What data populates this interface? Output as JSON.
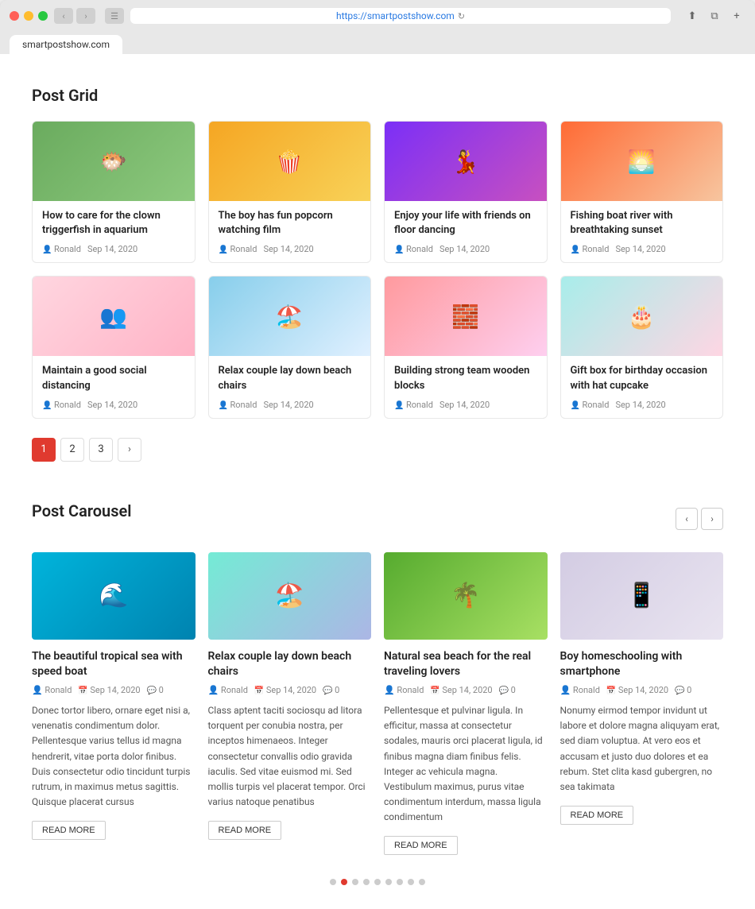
{
  "browser": {
    "url": "https://smartpostshow.com",
    "tab_label": "smartpostshow.com"
  },
  "page": {
    "post_grid": {
      "section_title": "Post Grid",
      "posts": [
        {
          "id": 1,
          "title": "How to care for the clown triggerfish in aquarium",
          "author": "Ronald",
          "date": "Sep 14, 2020",
          "img_class": "img-fish",
          "img_emoji": "🐡"
        },
        {
          "id": 2,
          "title": "The boy has fun popcorn watching film",
          "author": "Ronald",
          "date": "Sep 14, 2020",
          "img_class": "img-popcorn",
          "img_emoji": "🍿"
        },
        {
          "id": 3,
          "title": "Enjoy your life with friends on floor dancing",
          "author": "Ronald",
          "date": "Sep 14, 2020",
          "img_class": "img-dance",
          "img_emoji": "💃"
        },
        {
          "id": 4,
          "title": "Fishing boat river with breathtaking sunset",
          "author": "Ronald",
          "date": "Sep 14, 2020",
          "img_class": "img-sunset",
          "img_emoji": "🌅"
        },
        {
          "id": 5,
          "title": "Maintain a good social distancing",
          "author": "Ronald",
          "date": "Sep 14, 2020",
          "img_class": "img-social",
          "img_emoji": "👥"
        },
        {
          "id": 6,
          "title": "Relax couple lay down beach chairs",
          "author": "Ronald",
          "date": "Sep 14, 2020",
          "img_class": "img-beach-chairs",
          "img_emoji": "🏖️"
        },
        {
          "id": 7,
          "title": "Building strong team wooden blocks",
          "author": "Ronald",
          "date": "Sep 14, 2020",
          "img_class": "img-blocks",
          "img_emoji": "🧱"
        },
        {
          "id": 8,
          "title": "Gift box for birthday occasion with hat cupcake",
          "author": "Ronald",
          "date": "Sep 14, 2020",
          "img_class": "img-birthday",
          "img_emoji": "🎂"
        }
      ],
      "pagination": {
        "pages": [
          "1",
          "2",
          "3"
        ],
        "active": "1",
        "next_label": "›"
      }
    },
    "post_carousel": {
      "section_title": "Post Carousel",
      "prev_label": "‹",
      "next_label": "›",
      "posts": [
        {
          "id": 1,
          "title": "The beautiful tropical sea with speed boat",
          "author": "Ronald",
          "date": "Sep 14, 2020",
          "comments": "0",
          "img_class": "img-tropical",
          "img_emoji": "🌊",
          "excerpt": "Donec tortor libero, ornare eget nisi a, venenatis condimentum dolor. Pellentesque varius tellus id magna hendrerit, vitae porta dolor finibus. Duis consectetur odio tincidunt turpis rutrum, in maximus metus sagittis. Quisque placerat cursus",
          "read_more": "READ MORE"
        },
        {
          "id": 2,
          "title": "Relax couple lay down beach chairs",
          "author": "Ronald",
          "date": "Sep 14, 2020",
          "comments": "0",
          "img_class": "img-relax-beach",
          "img_emoji": "🏖️",
          "excerpt": "Class aptent taciti sociosqu ad litora torquent per conubia nostra, per inceptos himenaeos. Integer consectetur convallis odio gravida iaculis. Sed vitae euismod mi. Sed mollis turpis vel placerat tempor. Orci varius natoque penatibus",
          "read_more": "READ MORE"
        },
        {
          "id": 3,
          "title": "Natural sea beach for the real traveling lovers",
          "author": "Ronald",
          "date": "Sep 14, 2020",
          "comments": "0",
          "img_class": "img-sea-beach",
          "img_emoji": "🌴",
          "excerpt": "Pellentesque et pulvinar ligula. In efficitur, massa at consectetur sodales, mauris orci placerat ligula, id finibus magna diam finibus felis. Integer ac vehicula magna. Vestibulum maximus, purus vitae condimentum interdum, massa ligula condimentum",
          "read_more": "READ MORE"
        },
        {
          "id": 4,
          "title": "Boy homeschooling with smartphone",
          "author": "Ronald",
          "date": "Sep 14, 2020",
          "comments": "0",
          "img_class": "img-homeschool",
          "img_emoji": "📱",
          "excerpt": "Nonumy eirmod tempor invidunt ut labore et dolore magna aliquyam erat, sed diam voluptua. At vero eos et accusam et justo duo dolores et ea rebum. Stet clita kasd gubergren, no sea takimata",
          "read_more": "READ MORE"
        }
      ],
      "dots": [
        {
          "active": false
        },
        {
          "active": true
        },
        {
          "active": false
        },
        {
          "active": false
        },
        {
          "active": false
        },
        {
          "active": false
        },
        {
          "active": false
        },
        {
          "active": false
        },
        {
          "active": false
        }
      ]
    }
  }
}
